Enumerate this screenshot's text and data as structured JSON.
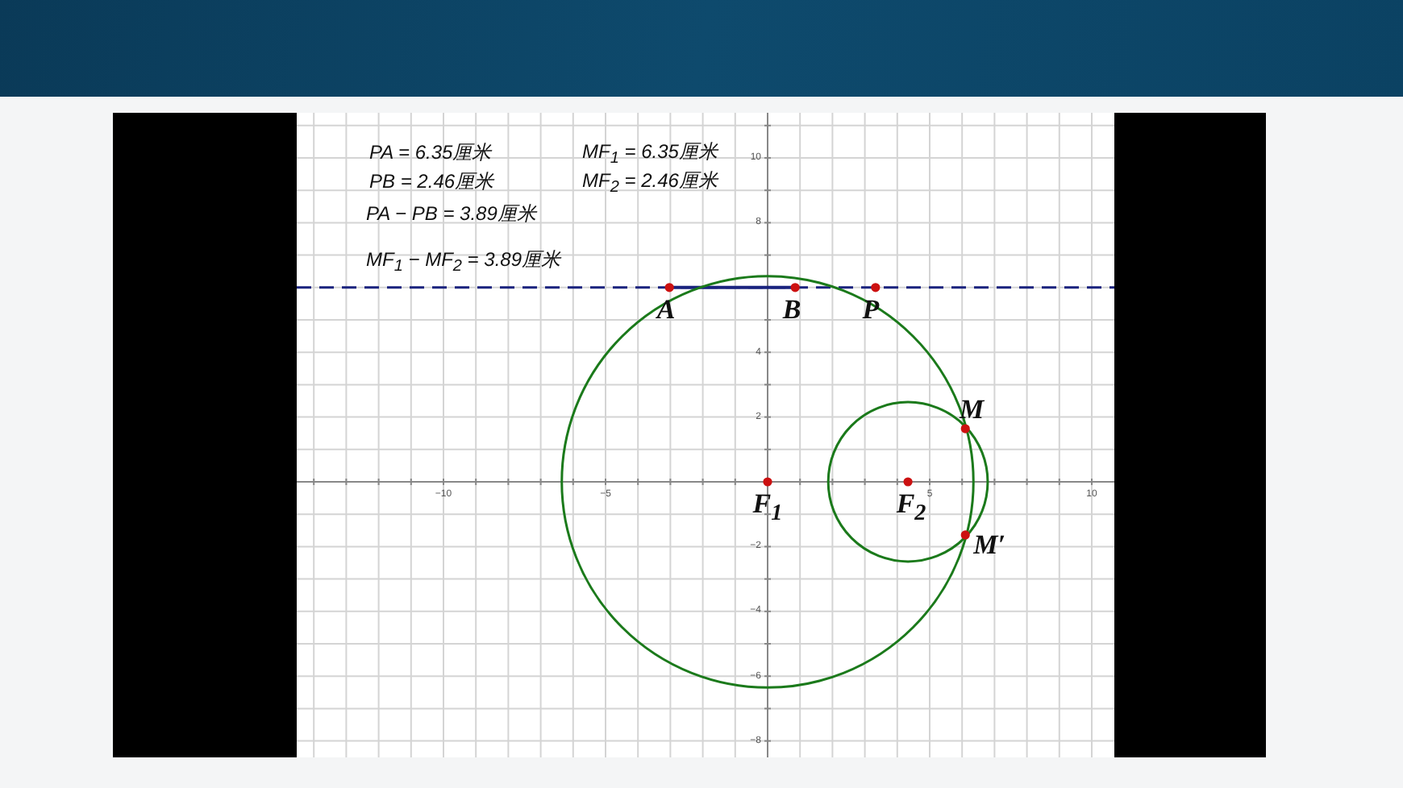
{
  "measurements": [
    {
      "text": "PA = 6.35厘米"
    },
    {
      "text": "MF$_{1}$ = 6.35厘米"
    },
    {
      "text": "PB = 2.46厘米"
    },
    {
      "text": "MF$_{2}$ = 2.46厘米"
    },
    {
      "text": "PA − PB = 3.89厘米"
    },
    {
      "text": "MF$_{1}$ − MF$_{2}$ = 3.89厘米"
    }
  ],
  "points": [
    {
      "label": "A"
    },
    {
      "label": "B"
    },
    {
      "label": "P"
    },
    {
      "label": "F$_{1}$"
    },
    {
      "label": "F$_{2}$"
    },
    {
      "label": "M"
    },
    {
      "label": "M′"
    }
  ],
  "x_axis_labels": [
    "−10",
    "−5",
    "5",
    "10"
  ],
  "y_axis_labels": [
    "10",
    "8",
    "4",
    "2",
    "−2",
    "−4",
    "−6",
    "−8"
  ]
}
